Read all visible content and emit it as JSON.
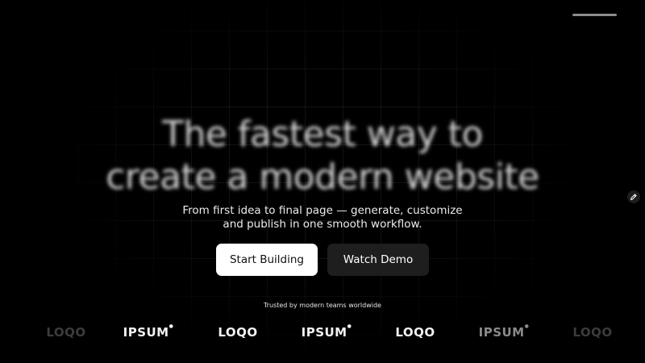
{
  "hero": {
    "headline_line1": "The fastest way to",
    "headline_line2": "create a modern website",
    "subtitle_line1": "From first idea to final page — generate, customize",
    "subtitle_line2": "and publish in one smooth workflow."
  },
  "actions": {
    "primary_label": "Start Building",
    "secondary_label": "Watch Demo"
  },
  "social_proof": {
    "trusted_text": "Trusted by modern teams worldwide",
    "logos": [
      "LOQO",
      "IPSUM",
      "LOQO",
      "IPSUM",
      "LOQO",
      "IPSUM",
      "LOQO"
    ]
  },
  "colors": {
    "background": "#000000",
    "primary_button": "#ffffff",
    "secondary_button": "#1e1e1e"
  },
  "icons": {
    "edit": "pencil-icon"
  }
}
